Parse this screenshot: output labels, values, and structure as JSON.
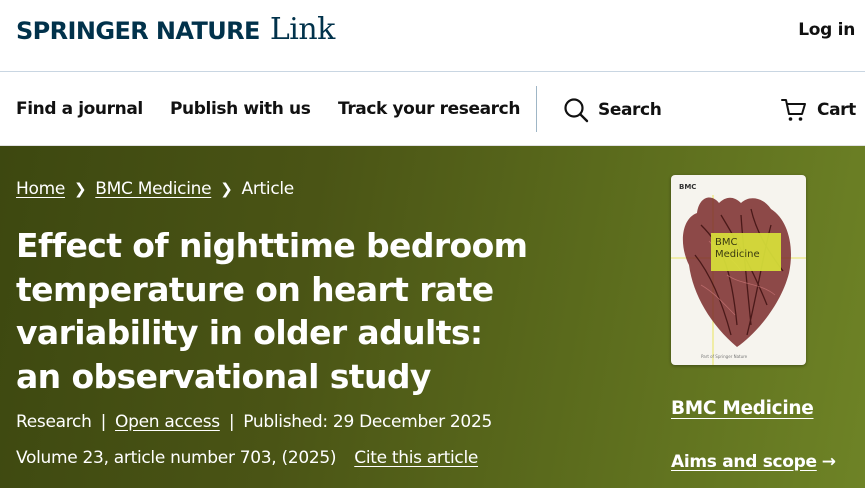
{
  "header": {
    "brand_main": "SPRINGER NATURE",
    "brand_sub": "Link",
    "login_label": "Log in"
  },
  "nav": {
    "find_journal": "Find a journal",
    "publish": "Publish with us",
    "track": "Track your research",
    "search": "Search",
    "cart": "Cart"
  },
  "breadcrumb": {
    "home": "Home",
    "journal": "BMC Medicine",
    "current": "Article"
  },
  "article": {
    "title": "Effect of nighttime bedroom temperature on heart rate variability in older adults: an observational study",
    "type": "Research",
    "access": "Open access",
    "published": "Published: 29 December 2025",
    "volume": "Volume 23, article number 703, (2025)",
    "cite": "Cite this article"
  },
  "journal": {
    "cover_publisher": "BMC",
    "cover_title_line1": "BMC",
    "cover_title_line2": "Medicine",
    "cover_footer": "Part of Springer Nature",
    "name": "BMC Medicine",
    "aims_label": "Aims and scope",
    "aims_arrow": "→"
  },
  "colors": {
    "brand_navy": "#01324b",
    "hero_dark": "#3d4810",
    "hero_light": "#6e8326",
    "cover_label": "#d8e23a"
  }
}
